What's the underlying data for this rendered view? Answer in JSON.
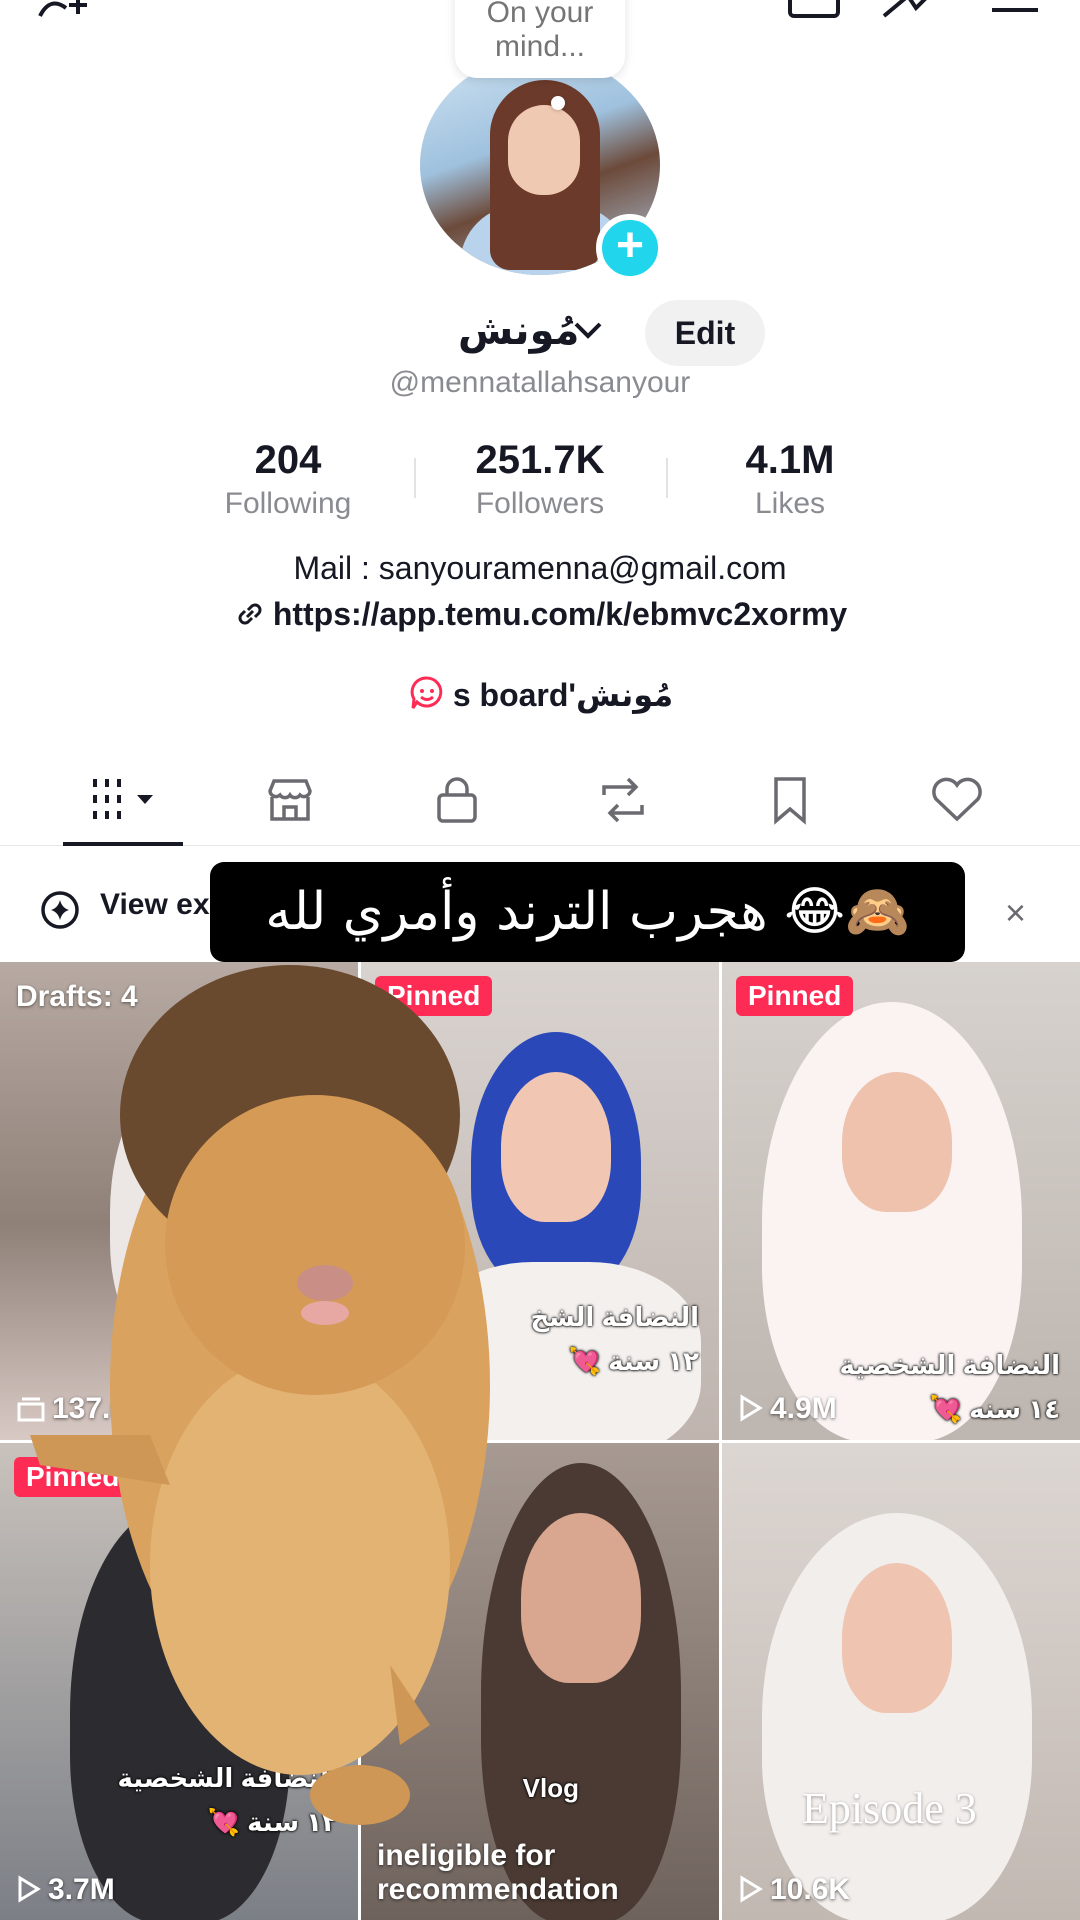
{
  "header": {
    "thought_bubble": "On your mind...",
    "display_name": "مُونش",
    "edit_label": "Edit",
    "username": "@mennatallahsanyour"
  },
  "stats": [
    {
      "value": "204",
      "label": "Following"
    },
    {
      "value": "251.7K",
      "label": "Followers"
    },
    {
      "value": "4.1M",
      "label": "Likes"
    }
  ],
  "bio": {
    "mail": "Mail : sanyouramenna@gmail.com",
    "link": "https://app.temu.com/k/ebmvc2xormy",
    "board": "s board'مُونش"
  },
  "tabs": [
    "videos",
    "shop",
    "private",
    "reposts",
    "favorites",
    "liked"
  ],
  "banner": {
    "text": "View ex",
    "close": "×"
  },
  "caption": "هجرب الترند وأمري لله 😂🙈",
  "grid": {
    "drafts_label": "Drafts: 4",
    "pinned_label": "Pinned",
    "cells": [
      {
        "views": "137.6M"
      },
      {
        "overlay1": "النضافة الشخ",
        "overlay2": "١٢ سنة 💘"
      },
      {
        "views": "4.9M",
        "overlay1": "النضافة الشخصية",
        "overlay2": "١٤ سنه 💘"
      },
      {
        "views": "3.7M",
        "overlay1": "النضافة الشخصية",
        "overlay2": "١٢ سنة 💘"
      },
      {
        "line1": "ineligible for",
        "line2": "recommendation",
        "overlay": "Vlog"
      },
      {
        "views": "10.6K",
        "episode": "Episode 3"
      }
    ]
  },
  "colors": {
    "accent": "#fe2c55",
    "avatar_add": "#20d5ec",
    "muted": "#8a8b91"
  }
}
